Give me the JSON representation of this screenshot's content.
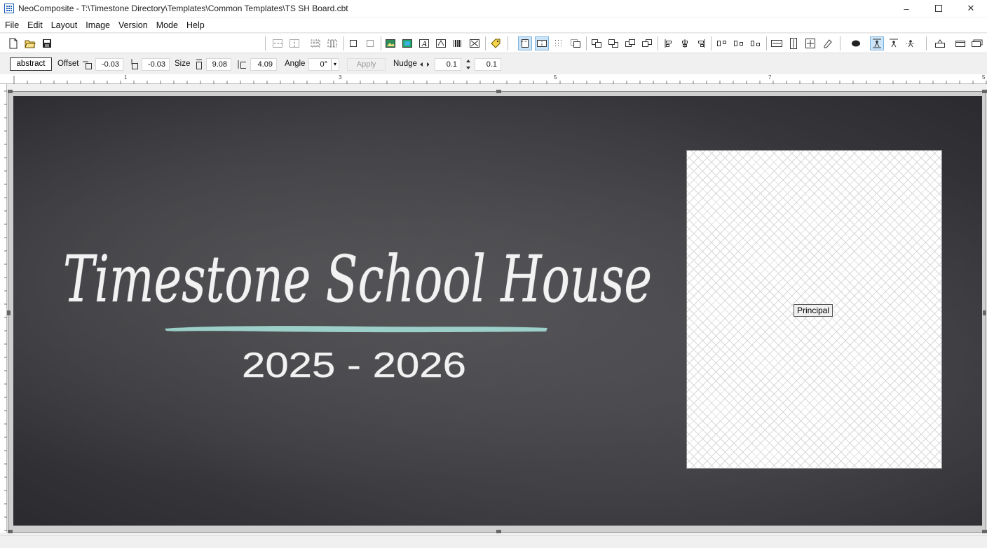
{
  "window": {
    "title": "NeoComposite - T:\\Timestone Directory\\Templates\\Common Templates\\TS SH Board.cbt",
    "controls": {
      "minimize": "–",
      "close": "✕"
    }
  },
  "menu": [
    "File",
    "Edit",
    "Layout",
    "Image",
    "Version",
    "Mode",
    "Help"
  ],
  "properties": {
    "object_name": "abstract",
    "offset_label": "Offset",
    "offset_x": "-0.03",
    "offset_y": "-0.03",
    "size_label": "Size",
    "width": "9.08",
    "height": "4.09",
    "angle_label": "Angle",
    "angle": "0°",
    "apply_label": "Apply",
    "nudge_label": "Nudge",
    "nudge_x": "0.1",
    "nudge_y": "0.1"
  },
  "ruler": {
    "ticks": [
      "1",
      "3",
      "5",
      "7",
      "5"
    ]
  },
  "board": {
    "title": "Timestone School House",
    "years": "2025 - 2026",
    "placeholder_label": "Principal",
    "accent_color": "#9fd6cf"
  }
}
